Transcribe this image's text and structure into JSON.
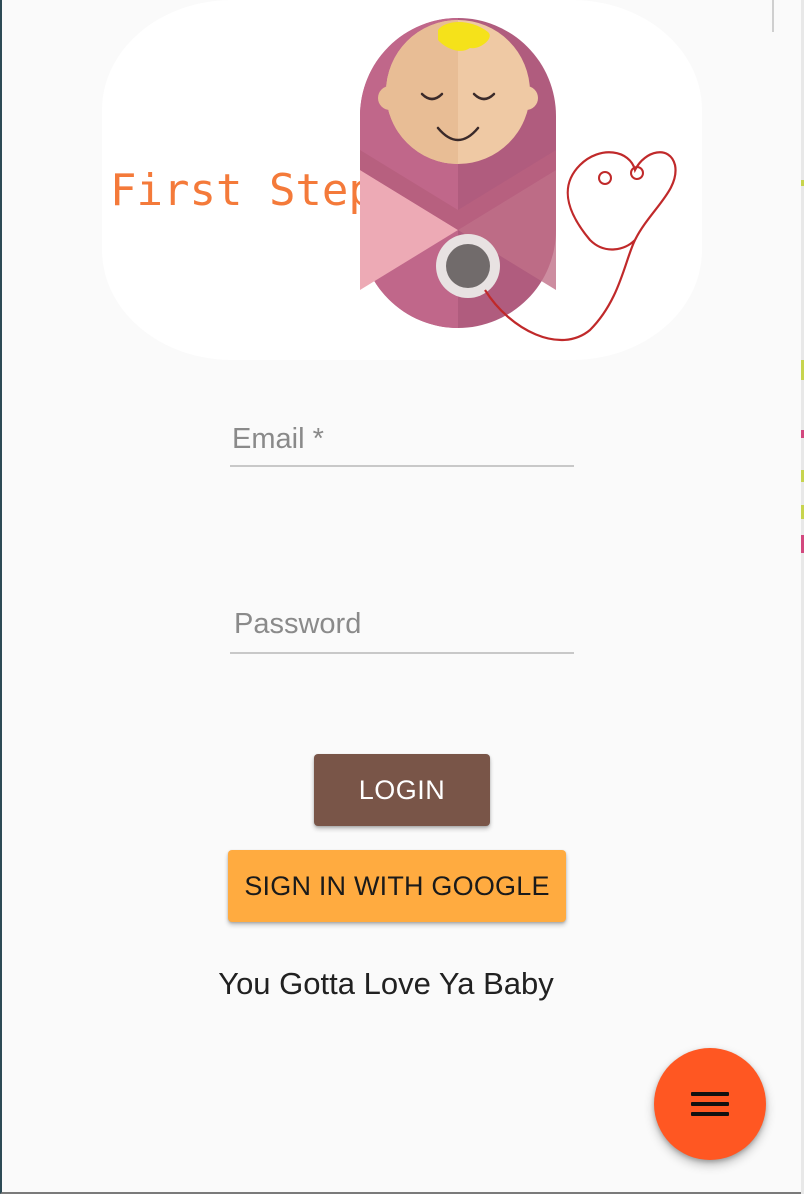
{
  "branding": {
    "logo_text": "First Steps",
    "colors": {
      "logo_text": "#f47a3a",
      "swaddle": "#b05c7e",
      "face": "#efc9a4",
      "hair": "#f5e21a",
      "stethoscope": "#c0292a"
    }
  },
  "login_form": {
    "email_label": "Email *",
    "password_label": "Password",
    "email_value": "",
    "password_value": ""
  },
  "buttons": {
    "login_label": "LOGIN",
    "google_label": "SIGN IN WITH GOOGLE",
    "login_color": "#795548",
    "google_color": "#ffab40"
  },
  "tagline": "You Gotta Love Ya Baby",
  "fab": {
    "icon": "menu-icon",
    "color": "#ff5722"
  }
}
